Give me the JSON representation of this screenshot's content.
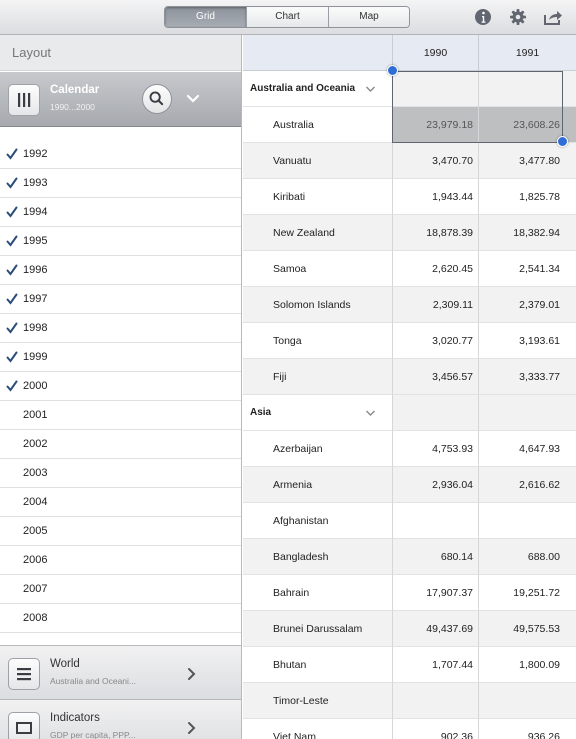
{
  "toolbar": {
    "tabs": [
      {
        "label": "Grid",
        "active": true
      },
      {
        "label": "Chart",
        "active": false
      },
      {
        "label": "Map",
        "active": false
      }
    ],
    "icons": [
      "info-icon",
      "gear-icon",
      "share-icon"
    ]
  },
  "sidebar": {
    "header": "Layout",
    "calendar": {
      "title": "Calendar",
      "subtitle": "1990...2000"
    },
    "years": [
      {
        "label": "1992",
        "checked": true
      },
      {
        "label": "1993",
        "checked": true
      },
      {
        "label": "1994",
        "checked": true
      },
      {
        "label": "1995",
        "checked": true
      },
      {
        "label": "1996",
        "checked": true
      },
      {
        "label": "1997",
        "checked": true
      },
      {
        "label": "1998",
        "checked": true
      },
      {
        "label": "1999",
        "checked": true
      },
      {
        "label": "2000",
        "checked": true
      },
      {
        "label": "2001",
        "checked": false
      },
      {
        "label": "2002",
        "checked": false
      },
      {
        "label": "2003",
        "checked": false
      },
      {
        "label": "2004",
        "checked": false
      },
      {
        "label": "2005",
        "checked": false
      },
      {
        "label": "2006",
        "checked": false
      },
      {
        "label": "2007",
        "checked": false
      },
      {
        "label": "2008",
        "checked": false
      }
    ],
    "world": {
      "title": "World",
      "subtitle": "Australia and Oceani..."
    },
    "indicators": {
      "title": "Indicators",
      "subtitle": "GDP per capita, PPP..."
    }
  },
  "grid": {
    "columns": [
      "1990",
      "1991"
    ],
    "rows": [
      {
        "type": "group",
        "name": "Australia and Oceania"
      },
      {
        "type": "item",
        "name": "Australia",
        "v1": "23,979.18",
        "v2": "23,608.26",
        "selected": true
      },
      {
        "type": "item",
        "name": "Vanuatu",
        "v1": "3,470.70",
        "v2": "3,477.80"
      },
      {
        "type": "item",
        "name": "Kiribati",
        "v1": "1,943.44",
        "v2": "1,825.78"
      },
      {
        "type": "item",
        "name": "New Zealand",
        "v1": "18,878.39",
        "v2": "18,382.94"
      },
      {
        "type": "item",
        "name": "Samoa",
        "v1": "2,620.45",
        "v2": "2,541.34"
      },
      {
        "type": "item",
        "name": "Solomon Islands",
        "v1": "2,309.11",
        "v2": "2,379.01"
      },
      {
        "type": "item",
        "name": "Tonga",
        "v1": "3,020.77",
        "v2": "3,193.61"
      },
      {
        "type": "item",
        "name": "Fiji",
        "v1": "3,456.57",
        "v2": "3,333.77"
      },
      {
        "type": "group",
        "name": "Asia"
      },
      {
        "type": "item",
        "name": "Azerbaijan",
        "v1": "4,753.93",
        "v2": "4,647.93"
      },
      {
        "type": "item",
        "name": "Armenia",
        "v1": "2,936.04",
        "v2": "2,616.62"
      },
      {
        "type": "item",
        "name": "Afghanistan",
        "v1": "",
        "v2": ""
      },
      {
        "type": "item",
        "name": "Bangladesh",
        "v1": "680.14",
        "v2": "688.00"
      },
      {
        "type": "item",
        "name": "Bahrain",
        "v1": "17,907.37",
        "v2": "19,251.72"
      },
      {
        "type": "item",
        "name": "Brunei Darussalam",
        "v1": "49,437.69",
        "v2": "49,575.53"
      },
      {
        "type": "item",
        "name": "Bhutan",
        "v1": "1,707.44",
        "v2": "1,800.09"
      },
      {
        "type": "item",
        "name": "Timor-Leste",
        "v1": "",
        "v2": ""
      },
      {
        "type": "item",
        "name": "Viet Nam",
        "v1": "902.36",
        "v2": "936.26"
      }
    ]
  },
  "colors": {
    "accent": "#2f6ed6",
    "check": "#2a4d7a"
  }
}
